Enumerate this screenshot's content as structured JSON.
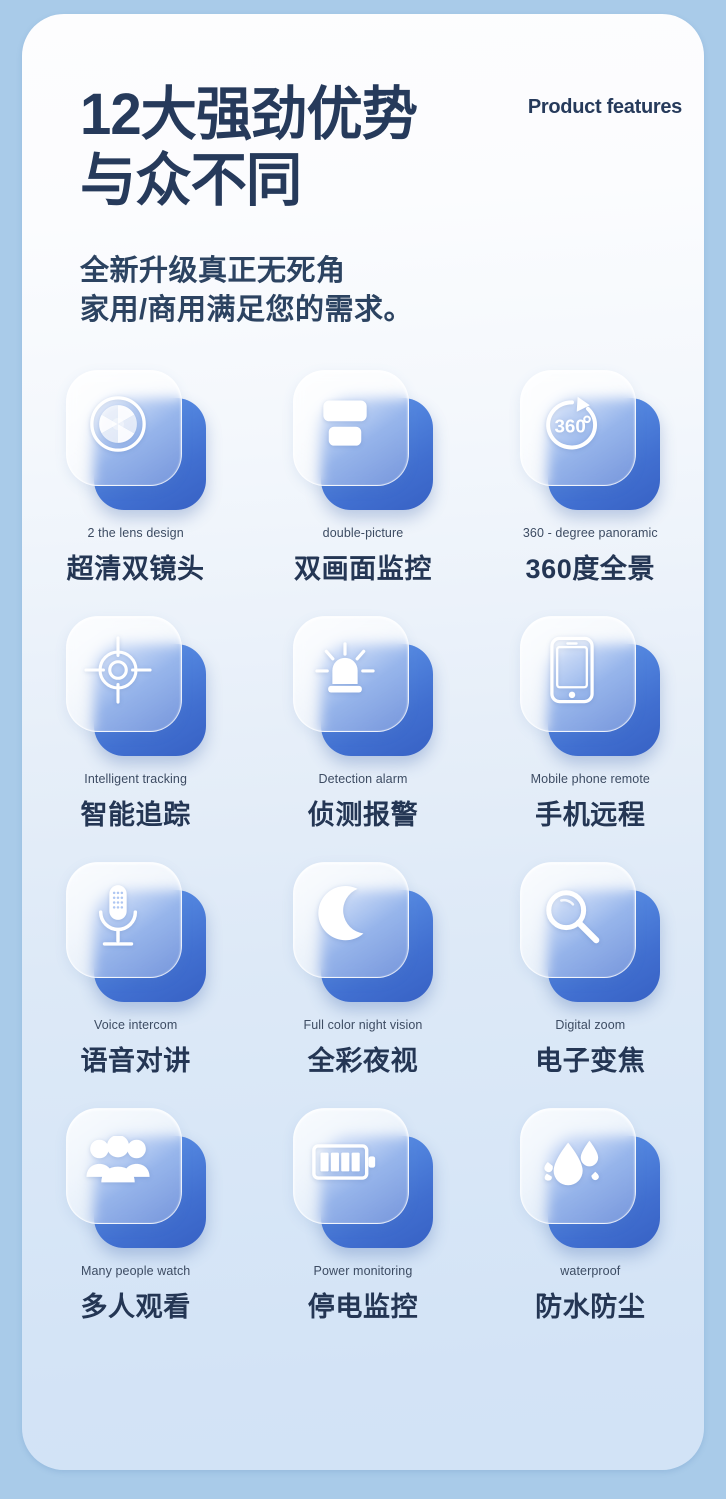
{
  "header": {
    "title": "12大强劲优势\n与众不同",
    "badge": "Product\nfeatures",
    "subtitle": "全新升级真正无死角\n家用/商用满足您的需求。"
  },
  "colors": {
    "page_background": "#a9cbe9",
    "panel_top": "#fdfdfe",
    "panel_bottom": "#d2e3f6",
    "heading": "#263a5b",
    "subtitle": "#2c4361",
    "tile_blue_light": "#6e9ae8",
    "tile_blue_dark": "#3761c4",
    "label_en": "#3d4c63",
    "label_cn": "#243654"
  },
  "features": [
    {
      "icon": "aperture-lens-icon",
      "en": "2 the lens design",
      "cn": "超清双镜头"
    },
    {
      "icon": "double-picture-icon",
      "en": "double-picture",
      "cn": "双画面监控"
    },
    {
      "icon": "360-panoramic-icon",
      "en": "360 - degree panoramic",
      "cn": "360度全景"
    },
    {
      "icon": "crosshair-target-icon",
      "en": "Intelligent tracking",
      "cn": "智能追踪"
    },
    {
      "icon": "alarm-siren-icon",
      "en": "Detection alarm",
      "cn": "侦测报警"
    },
    {
      "icon": "mobile-phone-icon",
      "en": "Mobile phone remote",
      "cn": "手机远程"
    },
    {
      "icon": "microphone-icon",
      "en": "Voice intercom",
      "cn": "语音对讲"
    },
    {
      "icon": "moon-stars-icon",
      "en": "Full color night vision",
      "cn": "全彩夜视"
    },
    {
      "icon": "magnifier-zoom-icon",
      "en": "Digital zoom",
      "cn": "电子变焦"
    },
    {
      "icon": "people-group-icon",
      "en": "Many people watch",
      "cn": "多人观看"
    },
    {
      "icon": "battery-icon",
      "en": "Power monitoring",
      "cn": "停电监控"
    },
    {
      "icon": "water-drop-icon",
      "en": "waterproof",
      "cn": "防水防尘"
    }
  ]
}
